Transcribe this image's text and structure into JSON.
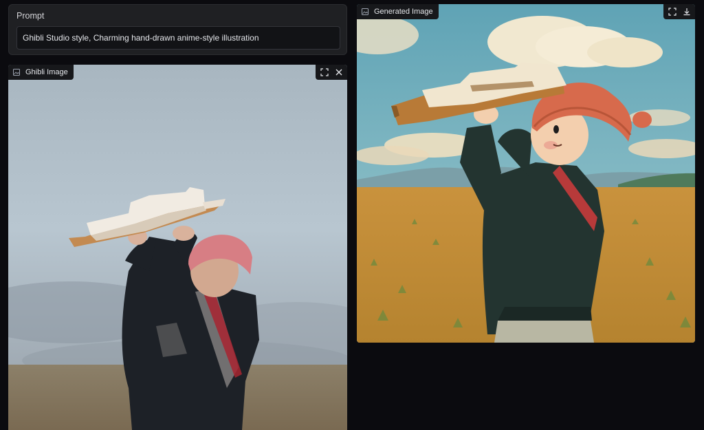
{
  "prompt": {
    "label": "Prompt",
    "value": "Ghibli Studio style, Charming hand-drawn anime-style illustration"
  },
  "input_image": {
    "label": "Ghibli Image",
    "label_icon": "image-icon",
    "actions": [
      "fullscreen-icon",
      "close-icon"
    ]
  },
  "output_image": {
    "label": "Generated Image",
    "label_icon": "image-icon",
    "actions": [
      "fullscreen-icon",
      "download-icon"
    ]
  },
  "colors": {
    "page_bg": "#0b0b0f",
    "block_bg": "#1f2023",
    "input_bg": "#121316",
    "label_bg": "#17181b"
  }
}
